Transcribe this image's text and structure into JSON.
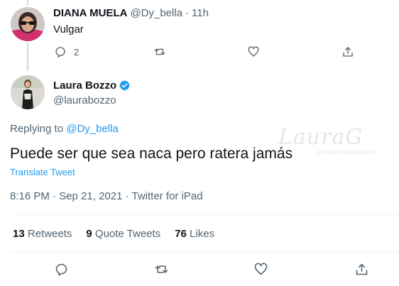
{
  "reply_tweet": {
    "name": "DIANA MUELA",
    "handle": "@Dy_bella",
    "time_sep": "·",
    "time": "11h",
    "text": "Vulgar",
    "reply_count": "2"
  },
  "main_tweet": {
    "name": "Laura Bozzo",
    "handle": "@laurabozzo",
    "verified": true,
    "replying_prefix": "Replying to",
    "replying_to": "@Dy_bella",
    "text": "Puede ser que sea naca pero ratera jamás",
    "translate_label": "Translate Tweet",
    "timestamp": "8:16 PM · Sep 21, 2021 · Twitter for iPad"
  },
  "stats": {
    "retweets_count": "13",
    "retweets_label": "Retweets",
    "quotes_count": "9",
    "quotes_label": "Quote Tweets",
    "likes_count": "76",
    "likes_label": "Likes"
  },
  "watermark": {
    "brand": "LauraG",
    "sub": "ENTRETENIMIENTO"
  },
  "colors": {
    "accent": "#1d9bf0",
    "muted": "#536471",
    "text": "#0f1419",
    "divider": "#eff3f4"
  }
}
